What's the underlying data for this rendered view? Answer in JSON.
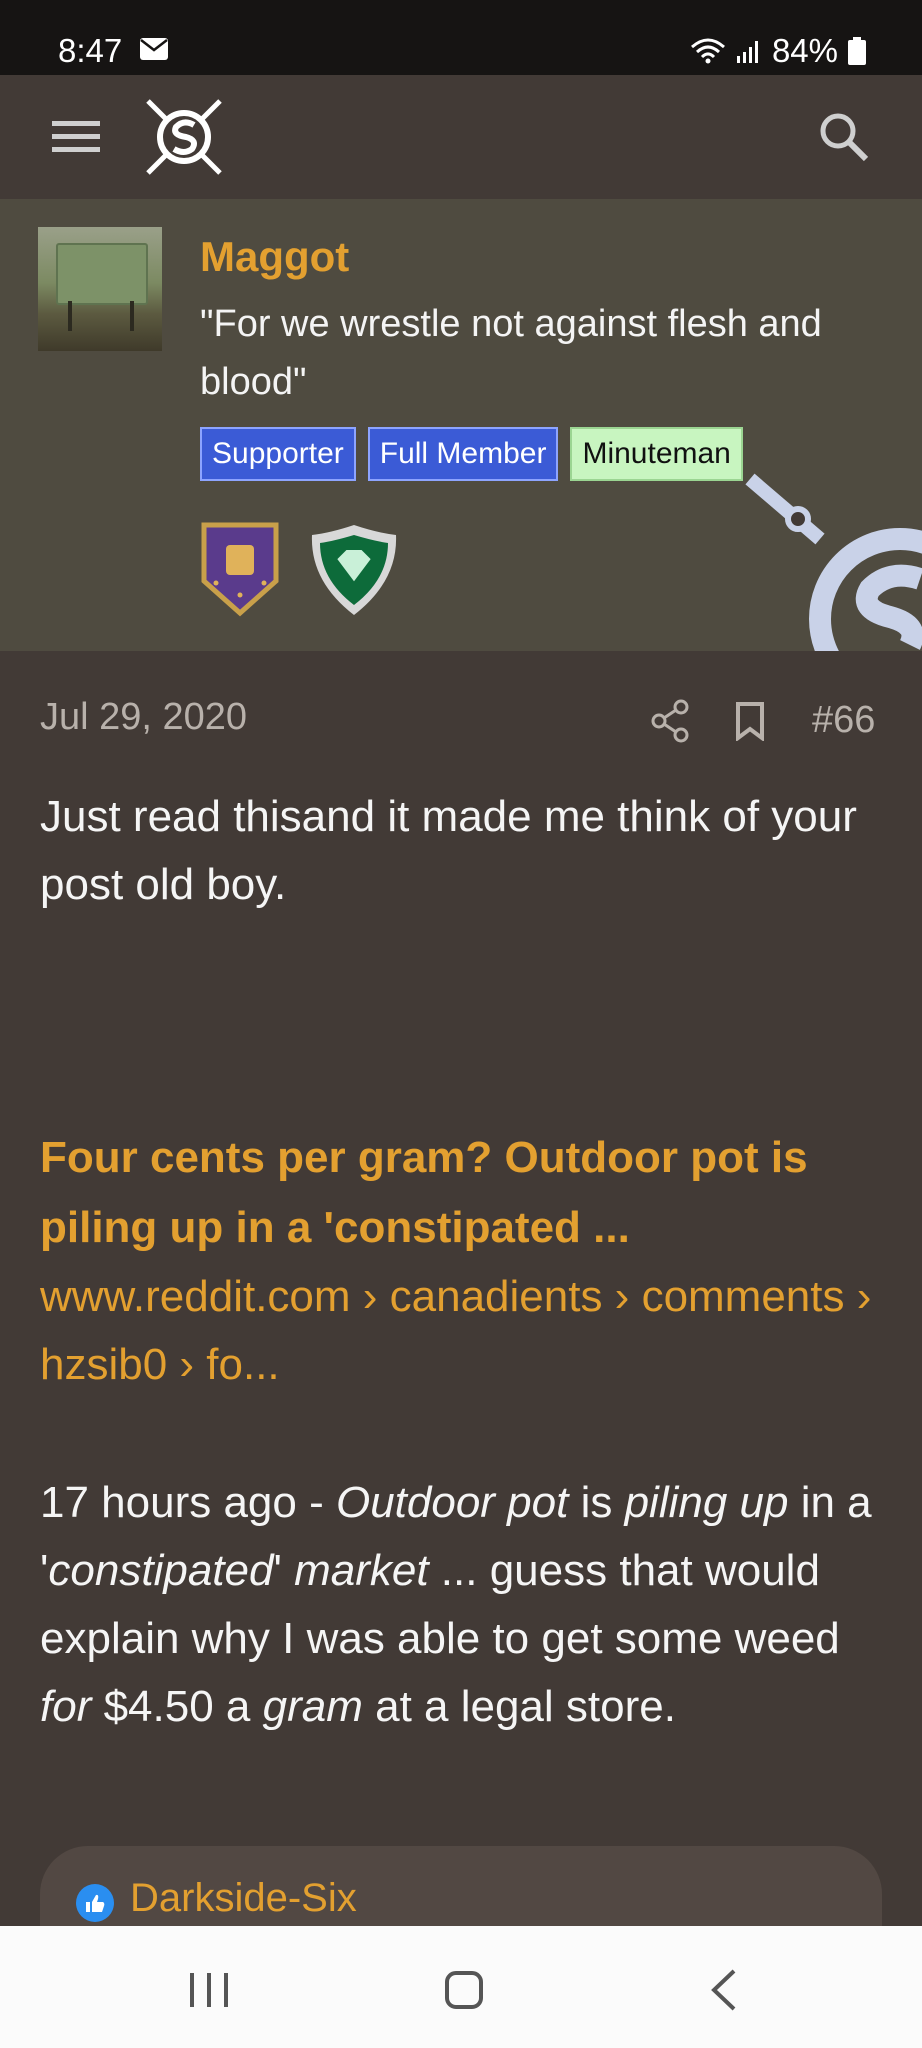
{
  "status": {
    "time": "8:47",
    "battery": "84%"
  },
  "header": {
    "menu_icon": "menu-icon",
    "logo_icon": "site-logo",
    "search_icon": "search-icon"
  },
  "user": {
    "name": "Maggot",
    "title": "\"For we wrestle not against flesh and blood\"",
    "badges": [
      "Supporter",
      "Full Member",
      "Minuteman"
    ]
  },
  "post": {
    "date": "Jul 29, 2020",
    "number": "#66",
    "body": "Just read thisand it made me think of your post old boy.",
    "link_title": "Four cents per gram? Outdoor pot is piling up in a 'constipated ...",
    "link_url": "www.reddit.com › canadients › comments › hzsib0 › fo...",
    "snippet": {
      "p1": "17 hours ago - ",
      "p2": "Outdoor pot",
      "p3": " is ",
      "p4": "piling up",
      "p5": " in a '",
      "p6": "constipated",
      "p7": "' ",
      "p8": "market",
      "p9": " ... guess that would explain why I was able to get some weed ",
      "p10": "for",
      "p11": " $4.50 a ",
      "p12": "gram",
      "p13": " at a legal store."
    },
    "reaction_user": "Darkside-Six"
  },
  "colors": {
    "accent": "#e3a030",
    "background": "#423a36",
    "user_block": "#4f4b40"
  }
}
